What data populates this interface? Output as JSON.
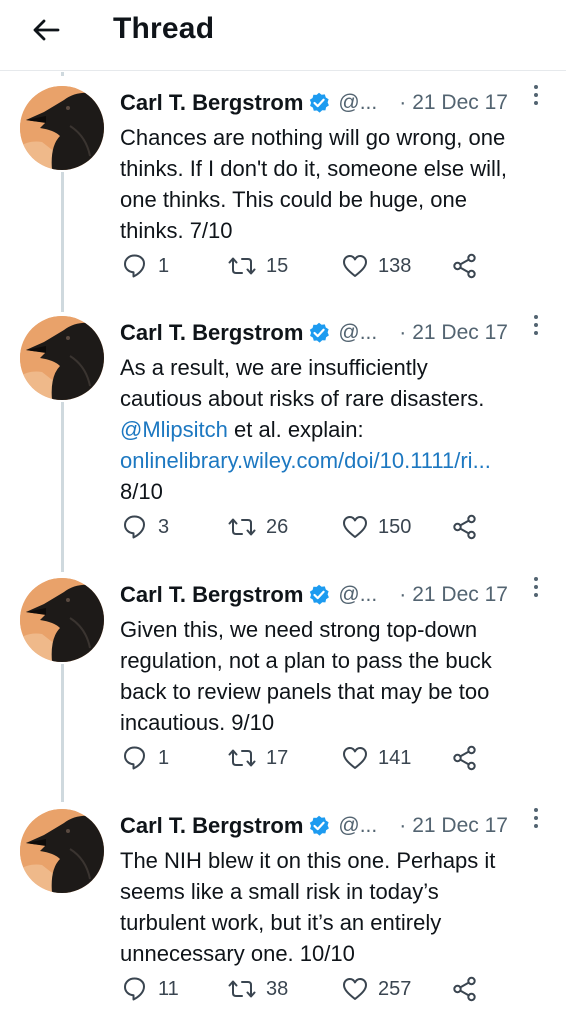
{
  "header": {
    "title": "Thread",
    "back_icon": "arrow-left-icon"
  },
  "author": {
    "name": "Carl T. Bergstrom",
    "handle": "@...",
    "verified_color": "#1d9bf0"
  },
  "tweets": [
    {
      "separator": "·",
      "date": "21 Dec 17",
      "lines": [
        "Chances are nothing will go wrong, one",
        "thinks. If I don't do it, someone else will,",
        "one thinks. This could be huge, one",
        "thinks. 7/10"
      ],
      "replies": "1",
      "retweets": "15",
      "likes": "138"
    },
    {
      "separator": "·",
      "date": "21 Dec 17",
      "lines": [
        "As a result, we are insufficiently",
        "cautious about risks of rare disasters."
      ],
      "mention": "@Mlipsitch",
      "mention_after": " et al. explain:",
      "link": "onlinelibrary.wiley.com/doi/10.1111/ri...",
      "tail": "8/10",
      "replies": "3",
      "retweets": "26",
      "likes": "150"
    },
    {
      "separator": "·",
      "date": "21 Dec 17",
      "lines": [
        "Given this, we need strong top-down",
        "regulation, not a plan to pass the buck",
        "back to review panels that may be too",
        "incautious. 9/10"
      ],
      "replies": "1",
      "retweets": "17",
      "likes": "141"
    },
    {
      "separator": "·",
      "date": "21 Dec 17",
      "lines": [
        "The NIH blew it on this one. Perhaps it",
        "seems like a small risk in today’s",
        "turbulent work, but it’s an entirely",
        "unnecessary one. 10/10"
      ],
      "replies": "11",
      "retweets": "38",
      "likes": "257"
    }
  ],
  "colors": {
    "link": "#1d78c1",
    "muted": "#536471",
    "thread_line": "#cfd9de"
  }
}
